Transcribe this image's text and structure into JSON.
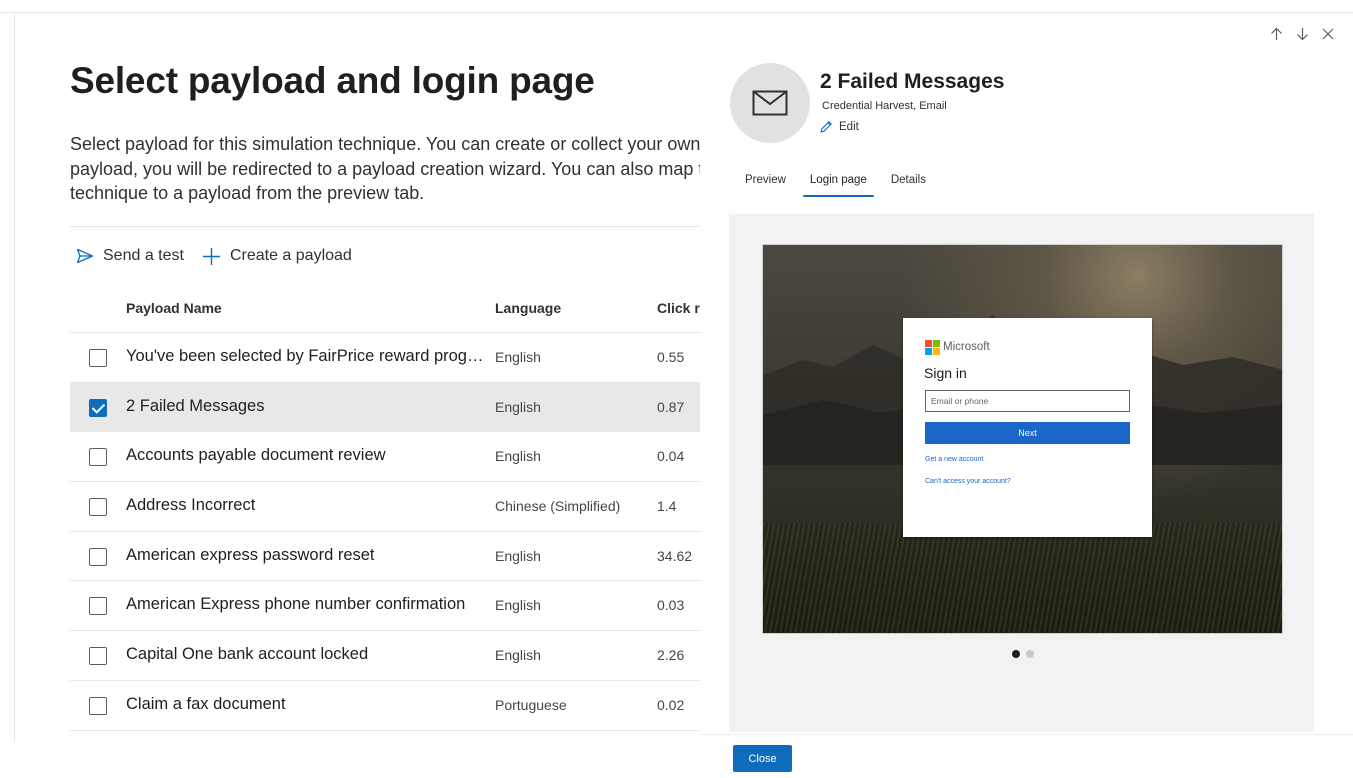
{
  "left": {
    "title": "Select payload and login page",
    "description": "Select payload for this simulation technique. You can create or collect your own payload, you will be redirected to a payload creation wizard. You can also map this technique to a payload from the preview tab.",
    "toolbar": {
      "send_test": "Send a test",
      "create_payload": "Create a payload"
    },
    "table": {
      "headers": {
        "name": "Payload Name",
        "language": "Language",
        "click_rate": "Click rate"
      },
      "rows": [
        {
          "name": "You've been selected by FairPrice reward programme",
          "language": "English",
          "click_rate": "0.55",
          "selected": false
        },
        {
          "name": "2 Failed Messages",
          "language": "English",
          "click_rate": "0.87",
          "selected": true
        },
        {
          "name": "Accounts payable document review",
          "language": "English",
          "click_rate": "0.04",
          "selected": false
        },
        {
          "name": "Address Incorrect",
          "language": "Chinese (Simplified)",
          "click_rate": "1.4",
          "selected": false
        },
        {
          "name": "American express password reset",
          "language": "English",
          "click_rate": "34.62",
          "selected": false
        },
        {
          "name": "American Express phone number confirmation",
          "language": "English",
          "click_rate": "0.03",
          "selected": false
        },
        {
          "name": "Capital One bank account locked",
          "language": "English",
          "click_rate": "2.26",
          "selected": false
        },
        {
          "name": "Claim a fax document",
          "language": "Portuguese",
          "click_rate": "0.02",
          "selected": false
        }
      ]
    }
  },
  "right": {
    "title": "2 Failed Messages",
    "subtitle": "Credential Harvest, Email",
    "edit_label": "Edit",
    "tabs": [
      "Preview",
      "Login page",
      "Details"
    ],
    "active_tab": "Login page",
    "signin": {
      "brand": "Microsoft",
      "heading": "Sign in",
      "email_placeholder": "Email or phone",
      "next_label": "Next",
      "create_account": "Get a new account",
      "cant_access": "Can't access your account?"
    },
    "carousel": {
      "count": 2,
      "active_index": 0
    },
    "close_label": "Close"
  },
  "colors": {
    "accent": "#0f6cbd",
    "selected_row": "#e8e8e8",
    "ms_red": "#f25022",
    "ms_green": "#7fba00",
    "ms_blue": "#00a4ef",
    "ms_yellow": "#ffb900"
  },
  "icons": {
    "send_test": "send-icon",
    "create_payload": "plus-icon",
    "edit": "pencil-icon",
    "payload": "envelope-icon",
    "window": [
      "arrow-up-icon",
      "arrow-down-icon",
      "close-icon"
    ]
  }
}
